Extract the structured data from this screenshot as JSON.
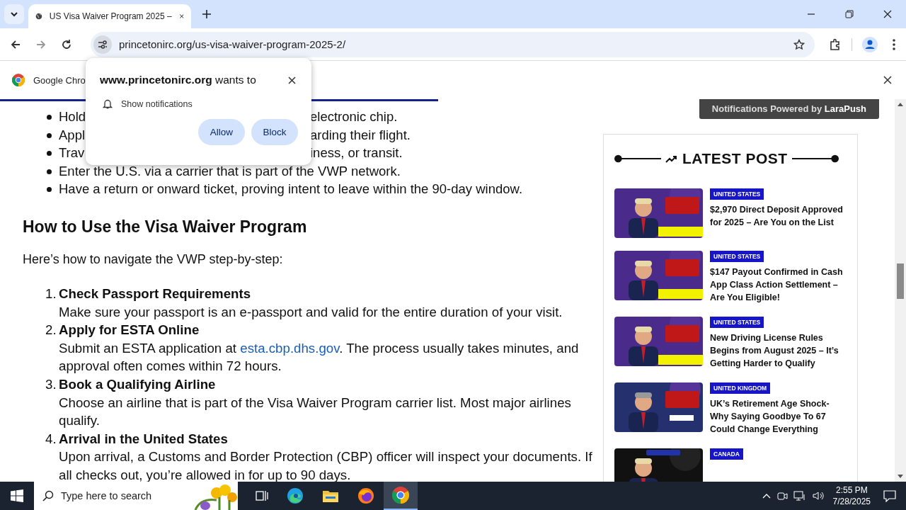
{
  "tab_bar": {
    "tabs": [
      {
        "title": "US Visa Waiver Program 2025 –",
        "selected": true
      }
    ]
  },
  "toolbar": {
    "url": "princetonirc.org/us-visa-waiver-program-2025-2/"
  },
  "infobar": {
    "text": "Google Chro"
  },
  "permission_popup": {
    "title": "**www.princetonirc.org** wants to",
    "permission": "Show notifications",
    "buttons": [
      "Allow",
      "Block"
    ]
  },
  "reading_progress": {
    "level": 0.49
  },
  "article": {
    "bullets": [
      {
        "parts": [
          "Hold",
          "electronic chip."
        ]
      },
      {
        "parts": [
          "Appl",
          "arding their flight."
        ]
      },
      {
        "parts": [
          "Trav",
          "iness, or transit."
        ]
      },
      {
        "parts": [
          "Enter the U.S. via a carrier that is part of the VWP network."
        ]
      },
      {
        "parts": [
          "Have a return or onward ticket, proving intent to leave within the 90-day window."
        ]
      }
    ],
    "heading": "How to Use the Visa Waiver Program",
    "intro": "Here’s how to navigate the VWP step-by-step:",
    "steps": [
      {
        "number": "1.",
        "title": "Check Passport Requirements",
        "body": [
          {
            "kind": "text",
            "text": "Make sure your passport is an e-passport and valid for the entire duration of your visit."
          }
        ]
      },
      {
        "number": "2.",
        "title": "Apply for ESTA Online",
        "body": [
          {
            "kind": "text",
            "text": "Submit an ESTA application at "
          },
          {
            "kind": "link",
            "text": "esta.cbp.dhs.gov"
          },
          {
            "kind": "text",
            "text": ". The process usually takes minutes, and approval often comes within 72 hours."
          }
        ]
      },
      {
        "number": "3.",
        "title": "Book a Qualifying Airline",
        "body": [
          {
            "kind": "text",
            "text": "Choose an airline that is part of the Visa Waiver Program carrier list. Most major airlines qualify."
          }
        ]
      },
      {
        "number": "4.",
        "title": "Arrival in the United States",
        "body": [
          {
            "kind": "text",
            "text": "Upon arrival, a Customs and Border Protection (CBP) officer will inspect your documents. If all checks out, you’re allowed in for up to 90 days."
          }
        ]
      }
    ]
  },
  "sidebar": {
    "badge": "Notifications Powered by **LaraPush**",
    "heading": "LATEST POST",
    "posts": [
      {
        "category": "UNITED STATES",
        "title": "$2,970 Direct Deposit Approved for 2025 – Are You on the List",
        "kind": "picture"
      },
      {
        "category": "UNITED STATES",
        "title": "$147 Payout Confirmed in Cash App Class Action Settlement – Are You Eligible!",
        "kind": "picture"
      },
      {
        "category": "UNITED STATES",
        "title": "New Driving License Rules Begins from August 2025 – It’s Getting Harder to Qualify",
        "kind": "picture"
      },
      {
        "category": "UNITED KINGDOM",
        "title": "UK’s Retirement Age Shock- Why Saying Goodbye To 67 Could Change Everything",
        "kind": "picture"
      },
      {
        "category": "CANADA",
        "kind": "picture"
      }
    ]
  },
  "taskbar": {
    "search_placeholder": "Type here to search",
    "time": "2:55 PM",
    "date": "7/28/2025"
  }
}
